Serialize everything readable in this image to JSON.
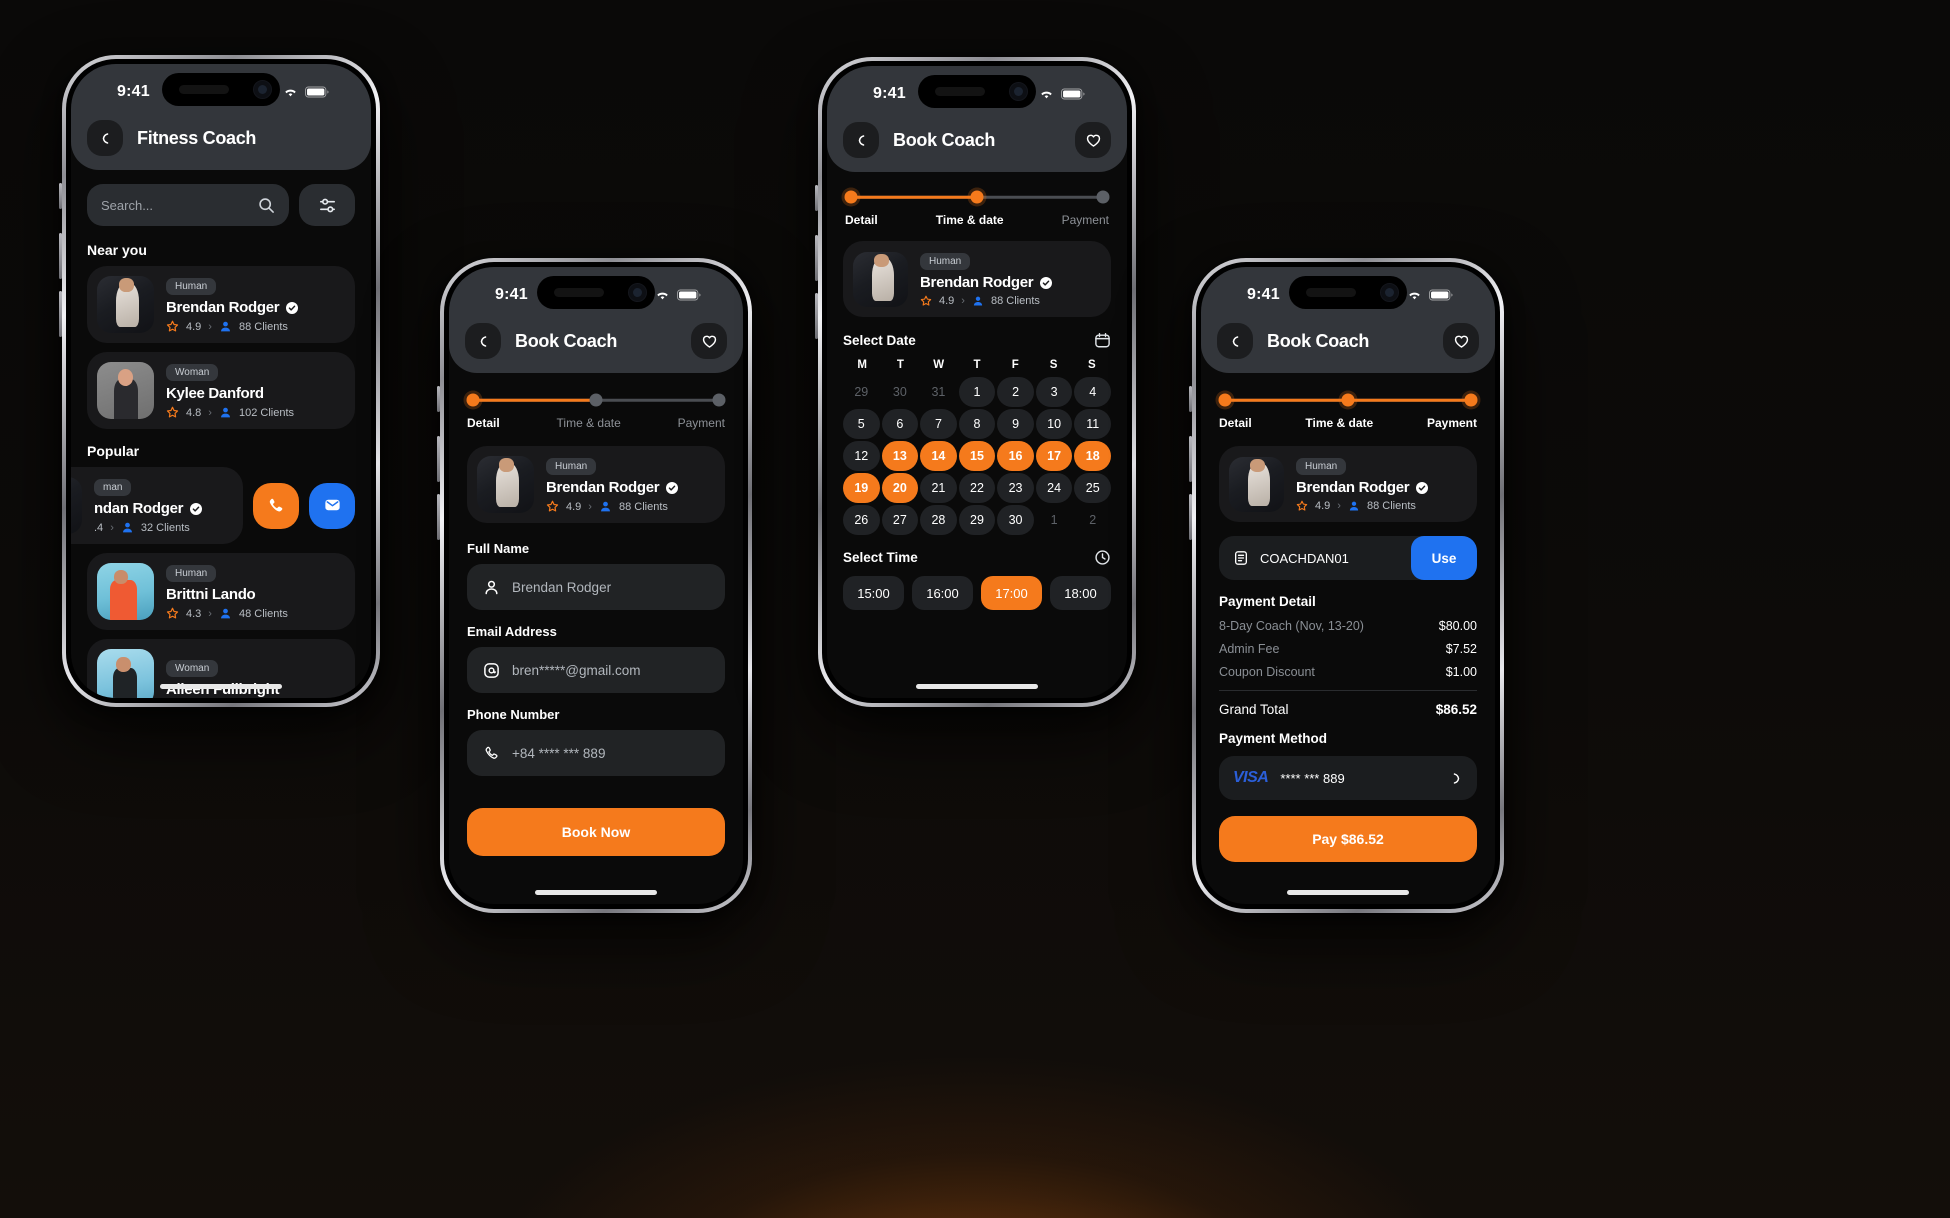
{
  "statusbar": {
    "time": "9:41",
    "signal_icon": "cellular-signal-icon",
    "wifi_icon": "wifi-icon",
    "battery_icon": "battery-icon"
  },
  "phone1": {
    "title": "Fitness Coach",
    "back_icon": "chevron-left-icon",
    "search": {
      "placeholder": "Search...",
      "icon": "search-icon"
    },
    "filter_icon": "filter-sliders-icon",
    "sections": [
      {
        "title": "Near you"
      },
      {
        "title": "Popular"
      }
    ],
    "near_you": [
      {
        "tag": "Human",
        "name": "Brendan Rodger",
        "verified": true,
        "rating": "4.9",
        "clients": "88 Clients",
        "photo": "brendan"
      },
      {
        "tag": "Woman",
        "name": "Kylee Danford",
        "verified": false,
        "rating": "4.8",
        "clients": "102 Clients",
        "photo": "kylee"
      }
    ],
    "popular": [
      {
        "tag": "man",
        "name": "ndan Rodger",
        "verified": true,
        "rating": ".4",
        "clients": "32 Clients",
        "photo": "brendan",
        "swiped": true,
        "actions": [
          {
            "icon": "phone-call-icon",
            "color": "#f57a1c"
          },
          {
            "icon": "message-icon",
            "color": "#1f72f0"
          }
        ]
      },
      {
        "tag": "Human",
        "name": "Brittni Lando",
        "verified": false,
        "rating": "4.3",
        "clients": "48 Clients",
        "photo": "brittni"
      },
      {
        "tag": "Woman",
        "name": "Aileen Fullbright",
        "verified": false,
        "rating": "",
        "clients": "",
        "photo": "aileen"
      }
    ]
  },
  "phone2": {
    "title": "Book Coach",
    "back_icon": "chevron-left-icon",
    "favorite_icon": "heart-icon",
    "steps": [
      {
        "label": "Detail",
        "state": "active"
      },
      {
        "label": "Time & date",
        "state": "inactive"
      },
      {
        "label": "Payment",
        "state": "inactive"
      }
    ],
    "coach": {
      "tag": "Human",
      "name": "Brendan Rodger",
      "verified": true,
      "rating": "4.9",
      "clients": "88 Clients",
      "photo": "brendan"
    },
    "fields": [
      {
        "label": "Full Name",
        "icon": "user-icon",
        "value": "Brendan Rodger"
      },
      {
        "label": "Email Address",
        "icon": "at-email-icon",
        "value": "bren*****@gmail.com"
      },
      {
        "label": "Phone Number",
        "icon": "phone-icon",
        "value": "+84 **** *** 889"
      }
    ],
    "cta": "Book Now"
  },
  "phone3": {
    "title": "Book Coach",
    "back_icon": "chevron-left-icon",
    "favorite_icon": "heart-icon",
    "steps": [
      {
        "label": "Detail",
        "state": "done"
      },
      {
        "label": "Time & date",
        "state": "active"
      },
      {
        "label": "Payment",
        "state": "inactive"
      }
    ],
    "coach": {
      "tag": "Human",
      "name": "Brendan Rodger",
      "verified": true,
      "rating": "4.9",
      "clients": "88 Clients",
      "photo": "brendan"
    },
    "select_date_label": "Select Date",
    "calendar_icon": "calendar-icon",
    "dow": [
      "M",
      "T",
      "W",
      "T",
      "F",
      "S",
      "S"
    ],
    "days": [
      {
        "n": "29",
        "t": "mut"
      },
      {
        "n": "30",
        "t": "mut"
      },
      {
        "n": "31",
        "t": "mut"
      },
      {
        "n": "1",
        "t": "cell"
      },
      {
        "n": "2",
        "t": "cell"
      },
      {
        "n": "3",
        "t": "cell"
      },
      {
        "n": "4",
        "t": "cell"
      },
      {
        "n": "5",
        "t": "cell"
      },
      {
        "n": "6",
        "t": "cell"
      },
      {
        "n": "7",
        "t": "cell"
      },
      {
        "n": "8",
        "t": "cell"
      },
      {
        "n": "9",
        "t": "cell"
      },
      {
        "n": "10",
        "t": "cell"
      },
      {
        "n": "11",
        "t": "cell"
      },
      {
        "n": "12",
        "t": "cell"
      },
      {
        "n": "13",
        "t": "sel"
      },
      {
        "n": "14",
        "t": "sel"
      },
      {
        "n": "15",
        "t": "sel"
      },
      {
        "n": "16",
        "t": "sel"
      },
      {
        "n": "17",
        "t": "sel"
      },
      {
        "n": "18",
        "t": "sel"
      },
      {
        "n": "19",
        "t": "sel"
      },
      {
        "n": "20",
        "t": "sel"
      },
      {
        "n": "21",
        "t": "cell"
      },
      {
        "n": "22",
        "t": "cell"
      },
      {
        "n": "23",
        "t": "cell"
      },
      {
        "n": "24",
        "t": "cell"
      },
      {
        "n": "25",
        "t": "cell"
      },
      {
        "n": "26",
        "t": "cell"
      },
      {
        "n": "27",
        "t": "cell"
      },
      {
        "n": "28",
        "t": "cell"
      },
      {
        "n": "29",
        "t": "cell"
      },
      {
        "n": "30",
        "t": "cell"
      },
      {
        "n": "1",
        "t": "mut"
      },
      {
        "n": "2",
        "t": "mut"
      }
    ],
    "select_time_label": "Select Time",
    "clock_icon": "clock-icon",
    "times": [
      {
        "label": "15:00",
        "selected": false
      },
      {
        "label": "16:00",
        "selected": false
      },
      {
        "label": "17:00",
        "selected": true
      },
      {
        "label": "18:00",
        "selected": false
      }
    ]
  },
  "phone4": {
    "title": "Book Coach",
    "back_icon": "chevron-left-icon",
    "favorite_icon": "heart-icon",
    "steps": [
      {
        "label": "Detail",
        "state": "done"
      },
      {
        "label": "Time & date",
        "state": "done"
      },
      {
        "label": "Payment",
        "state": "active"
      }
    ],
    "coach": {
      "tag": "Human",
      "name": "Brendan Rodger",
      "verified": true,
      "rating": "4.9",
      "clients": "88 Clients",
      "photo": "brendan"
    },
    "coupon": {
      "icon": "coupon-ticket-icon",
      "code": "COACHDAN01",
      "button": "Use"
    },
    "payment_detail_title": "Payment Detail",
    "lines": [
      {
        "label": "8-Day Coach (Nov, 13-20)",
        "value": "$80.00"
      },
      {
        "label": "Admin Fee",
        "value": "$7.52"
      },
      {
        "label": "Coupon Discount",
        "value": "$1.00"
      }
    ],
    "total": {
      "label": "Grand Total",
      "value": "$86.52"
    },
    "payment_method_title": "Payment Method",
    "card": {
      "brand": "VISA",
      "number": "**** *** 889",
      "chevron_icon": "chevron-right-icon"
    },
    "cta": "Pay $86.52"
  },
  "colors": {
    "accent": "#f57a1c",
    "blue": "#1f72f0",
    "card": "#19191b",
    "screen": "#0a0a0a"
  }
}
